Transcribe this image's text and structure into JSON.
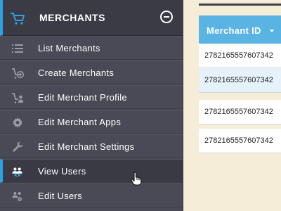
{
  "sidebar": {
    "header": {
      "title": "MERCHANTS",
      "icon": "cart-icon",
      "action_icon": "minus-circle-icon"
    },
    "accent_color": "#2ea1e0",
    "items": [
      {
        "label": "List Merchants",
        "icon": "list-icon"
      },
      {
        "label": "Create Merchants",
        "icon": "cart-add-icon"
      },
      {
        "label": "Edit Merchant Profile",
        "icon": "cart-user-icon"
      },
      {
        "label": "Edit Merchant Apps",
        "icon": "gear-icon"
      },
      {
        "label": "Edit Merchant Settings",
        "icon": "wrench-icon"
      },
      {
        "label": "View Users",
        "icon": "users-eye-icon",
        "active": true
      },
      {
        "label": "Edit Users",
        "icon": "users-gear-icon"
      }
    ]
  },
  "table": {
    "columns": [
      {
        "label": "Merchant ID",
        "sort_icon": "caret-down-icon"
      }
    ],
    "header_color": "#5ab4e3",
    "rows": [
      {
        "merchant_id": "2782165557607342"
      },
      {
        "merchant_id": "2782165557607342"
      },
      {
        "merchant_id": "2782165557607342"
      },
      {
        "merchant_id": "2782165557607342"
      }
    ]
  }
}
